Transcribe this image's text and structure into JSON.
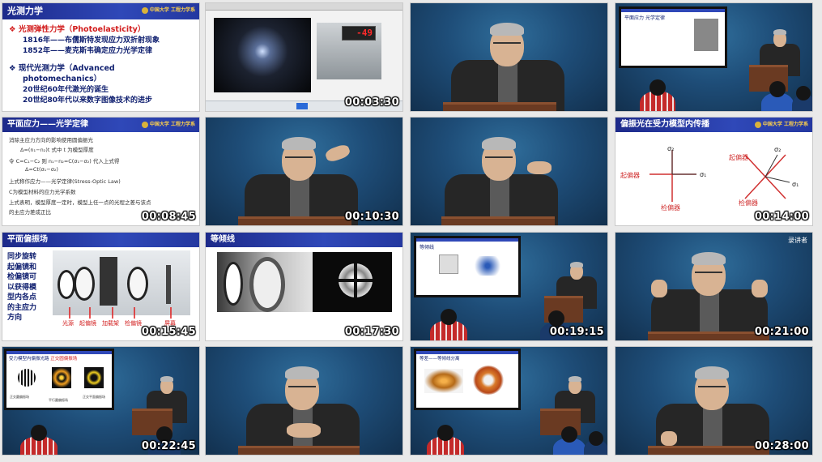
{
  "timestamps": [
    "",
    "00:03:30",
    "",
    "",
    "00:08:45",
    "00:10:30",
    "",
    "00:14:00",
    "00:15:45",
    "00:17:30",
    "00:19:15",
    "00:21:00",
    "00:22:45",
    "",
    "",
    "00:28:00"
  ],
  "tile1": {
    "title": "光测力学",
    "b1_title": "光测弹性力学（Photoelasticity）",
    "b1_line1": "1816年——布儒斯特发现应力双折射现象",
    "b1_line2": "1852年——麦克斯韦确定应力光学定律",
    "b2_title": "现代光测力学（Advanced",
    "b2_title2": "photomechanics）",
    "b2_line1": "20世纪60年代激光的诞生",
    "b2_line2": "20世纪80年代以来数字图像技术的进步"
  },
  "tile2": {
    "readout": "-49"
  },
  "tile4": {
    "slide_title": "平面应力",
    "slide_sub": "光学定律"
  },
  "tile5": {
    "title": "平面应力——光学定律",
    "lines": [
      "消除主应力方向的影响使用圆偏振光",
      "Δ=(n₁−n₂)t  式中 t 为模型厚度",
      "令 C=C₁−C₂  则 n₁−n₂=C(σ₁−σ₂) 代入上式得",
      "Δ=Ct(σ₁−σ₂)",
      "上式称作应力——光学定律(Stress-Optic Law)",
      "C为模型材料的应力光学系数",
      "上式表明，模型厚度一定时，模型上任一点的光程之差与该点",
      "的主应力差成正比"
    ]
  },
  "tile8": {
    "title": "偏振光在受力模型内传播",
    "left_label": "起偏器",
    "bottom_label": "检偏器",
    "right_top_label": "起偏器",
    "right_bottom_label": "检偏器",
    "sigma1": "σ₁",
    "sigma2": "σ₂"
  },
  "tile9": {
    "title": "平面偏振场",
    "side_text": [
      "同步旋转",
      "起偏镜和",
      "检偏镜可",
      "以获得模",
      "型内各点",
      "的主应力",
      "方向"
    ],
    "labels": [
      "光源",
      "起偏镜",
      "加载架",
      "检偏镜",
      "屏幕"
    ]
  },
  "tile10": {
    "title": "等倾线"
  },
  "tile11": {
    "slide_title": "等倾线"
  },
  "tile12": {
    "corner_text": "录讲者"
  },
  "tile13": {
    "slide_title": "受力模型内偏振光路",
    "slide_sub": "正交圆偏振场",
    "captions": [
      "正交圆偏振场",
      "平行圆偏振场",
      "正交平面偏振场"
    ]
  },
  "tile15": {
    "slide_title": "等差——等倾线分离"
  },
  "logo_text": "中国大学 工程力学系"
}
